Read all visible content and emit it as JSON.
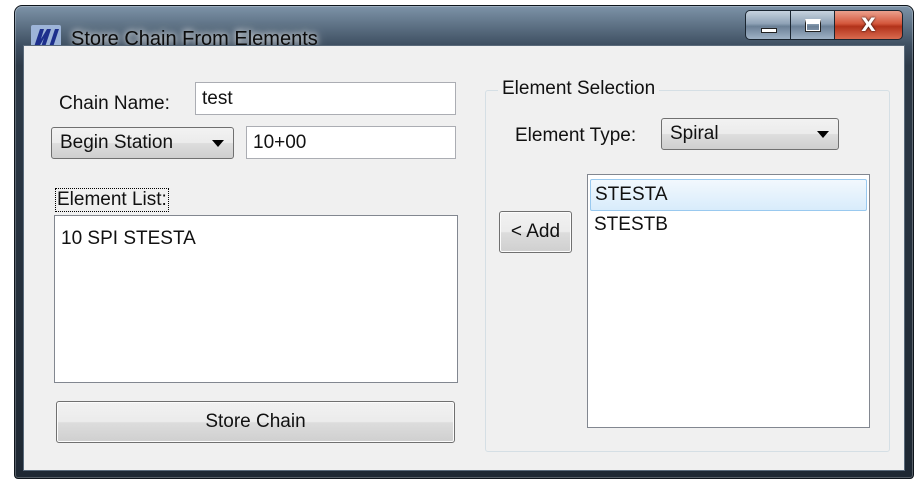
{
  "window": {
    "title": "Store Chain From Elements",
    "icon": "app-logo-icon",
    "caption_buttons": {
      "minimize": "minimize-icon",
      "maximize": "maximize-icon",
      "close": "X"
    }
  },
  "left": {
    "chain_name_label": "Chain Name:",
    "chain_name_value": "test",
    "station_combo_value": "Begin Station",
    "station_value": "10+00",
    "element_list_label": "Element List:",
    "element_list_items": [
      "10 SPI STESTA"
    ],
    "store_button_label": "Store Chain"
  },
  "right": {
    "group_title": "Element Selection",
    "element_type_label": "Element Type:",
    "element_type_value": "Spiral",
    "add_button_label": "< Add",
    "selection_items": [
      "STESTA",
      "STESTB"
    ],
    "selected_index": 0
  },
  "colors": {
    "dialog_bg": "#f0f0f0",
    "selection_highlight": "#d8ecfb",
    "close_button": "#c9432a",
    "titlebar": "#2d3a48"
  }
}
